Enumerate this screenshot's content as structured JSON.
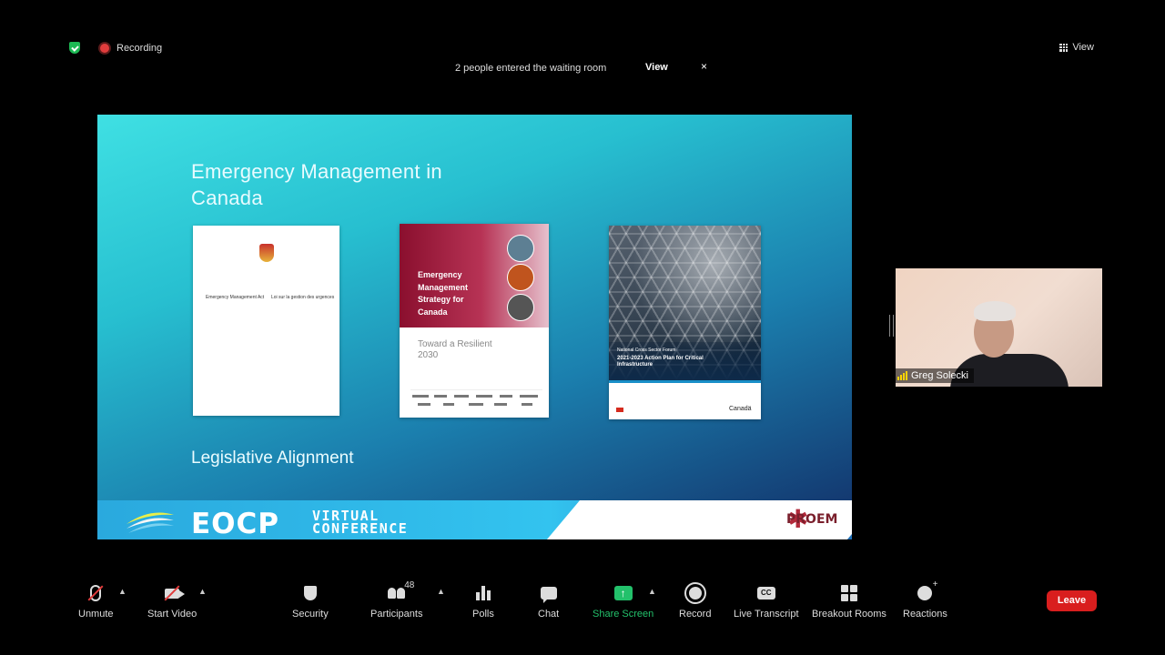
{
  "top": {
    "recording_label": "Recording",
    "view_label": "View",
    "notice": {
      "text": "2 people entered the waiting room",
      "view_label": "View",
      "close_glyph": "×"
    }
  },
  "slide": {
    "title": "Emergency Management in Canada",
    "subtitle": "Legislative Alignment",
    "doc1": {
      "left_heading": "Emergency Management Act",
      "right_heading": "Loi sur la gestion des urgences"
    },
    "doc2": {
      "title": "Emergency Management Strategy for Canada",
      "subtitle": "Toward a Resilient 2030"
    },
    "doc3": {
      "org": "National Cross Sector Forum",
      "title": "2021-2023 Action Plan for Critical Infrastructure",
      "footer_brand": "Canadä"
    },
    "banner": {
      "eocp": "EOCP",
      "virtual_line1": "VIRTUAL",
      "virtual_line2": "CONFERENCE",
      "proem": "PROEM"
    }
  },
  "video": {
    "participant_name": "Greg Solecki"
  },
  "toolbar": {
    "unmute": "Unmute",
    "start_video": "Start Video",
    "security": "Security",
    "participants": "Participants",
    "participants_count": "48",
    "polls": "Polls",
    "chat": "Chat",
    "share_screen": "Share Screen",
    "record": "Record",
    "live_transcript": "Live Transcript",
    "live_transcript_icon_text": "CC",
    "breakout_rooms": "Breakout Rooms",
    "reactions": "Reactions",
    "leave": "Leave"
  },
  "colors": {
    "share_green": "#23c16b",
    "leave_red": "#d91e1e",
    "recording_red": "#e03c3c",
    "secure_green": "#1db954"
  },
  "icons": [
    "secure-shield-icon",
    "recording-icon",
    "view-grid-icon",
    "close-icon",
    "mic-muted-icon",
    "video-off-icon",
    "security-shield-icon",
    "participants-icon",
    "polls-icon",
    "chat-icon",
    "share-screen-icon",
    "record-icon",
    "cc-icon",
    "breakout-rooms-icon",
    "reactions-icon"
  ]
}
